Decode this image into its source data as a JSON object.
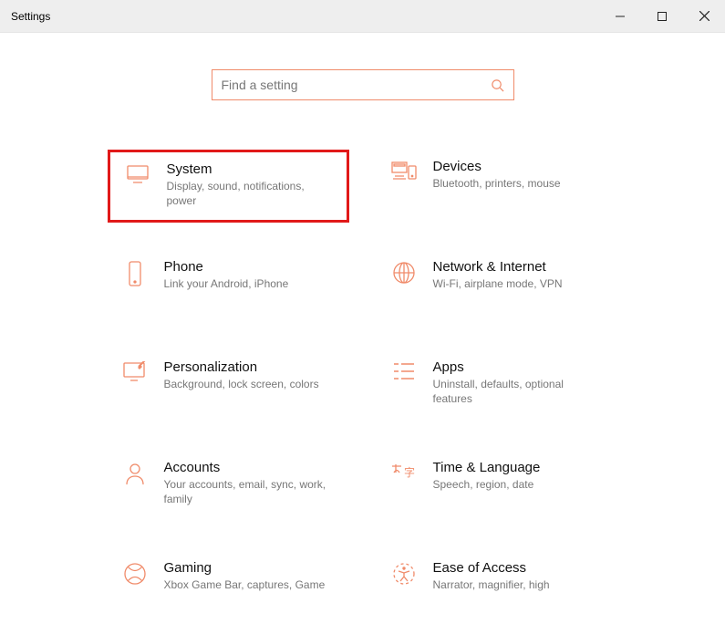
{
  "window": {
    "title": "Settings"
  },
  "search": {
    "placeholder": "Find a setting"
  },
  "tiles": [
    {
      "key": "system",
      "title": "System",
      "desc": "Display, sound, notifications, power",
      "highlighted": true
    },
    {
      "key": "devices",
      "title": "Devices",
      "desc": "Bluetooth, printers, mouse",
      "highlighted": false
    },
    {
      "key": "phone",
      "title": "Phone",
      "desc": "Link your Android, iPhone",
      "highlighted": false
    },
    {
      "key": "network",
      "title": "Network & Internet",
      "desc": "Wi-Fi, airplane mode, VPN",
      "highlighted": false
    },
    {
      "key": "personalization",
      "title": "Personalization",
      "desc": "Background, lock screen, colors",
      "highlighted": false
    },
    {
      "key": "apps",
      "title": "Apps",
      "desc": "Uninstall, defaults, optional features",
      "highlighted": false
    },
    {
      "key": "accounts",
      "title": "Accounts",
      "desc": "Your accounts, email, sync, work, family",
      "highlighted": false
    },
    {
      "key": "time",
      "title": "Time & Language",
      "desc": "Speech, region, date",
      "highlighted": false
    },
    {
      "key": "gaming",
      "title": "Gaming",
      "desc": "Xbox Game Bar, captures, Game",
      "highlighted": false
    },
    {
      "key": "ease",
      "title": "Ease of Access",
      "desc": "Narrator, magnifier, high",
      "highlighted": false
    }
  ]
}
